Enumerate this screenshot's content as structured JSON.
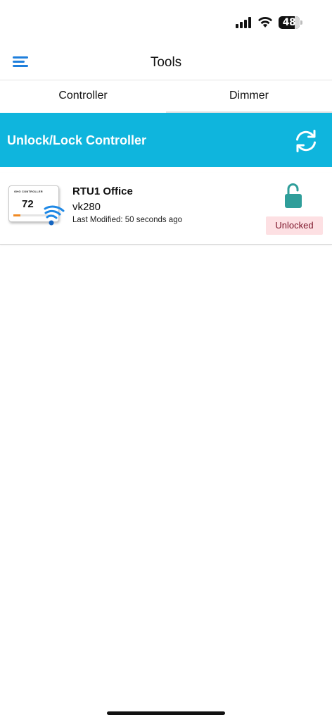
{
  "status_bar": {
    "battery_level": "48",
    "icons": [
      "cellular-signal-icon",
      "wifi-icon",
      "battery-icon"
    ]
  },
  "nav": {
    "title": "Tools",
    "menu_icon": "hamburger-menu-icon"
  },
  "tabs": [
    {
      "label": "Controller",
      "selected": true
    },
    {
      "label": "Dimmer",
      "selected": false
    }
  ],
  "banner": {
    "title": "Unlock/Lock Controller",
    "action_icon": "refresh-icon"
  },
  "controllers": [
    {
      "name": "RTU1 Office",
      "model": "vk280",
      "modified": "Last Modified: 50 seconds ago",
      "status": "Unlocked",
      "lock_icon": "unlocked-padlock-icon",
      "thumbnail": {
        "label": "GHG CONTROLLER",
        "temperature": "72"
      }
    }
  ],
  "colors": {
    "accent": "#0fb5dd",
    "menu_blue": "#1f7fdc",
    "lock_teal": "#2f9e9a",
    "badge_bg": "#fde0e3",
    "badge_text": "#7a1025"
  }
}
